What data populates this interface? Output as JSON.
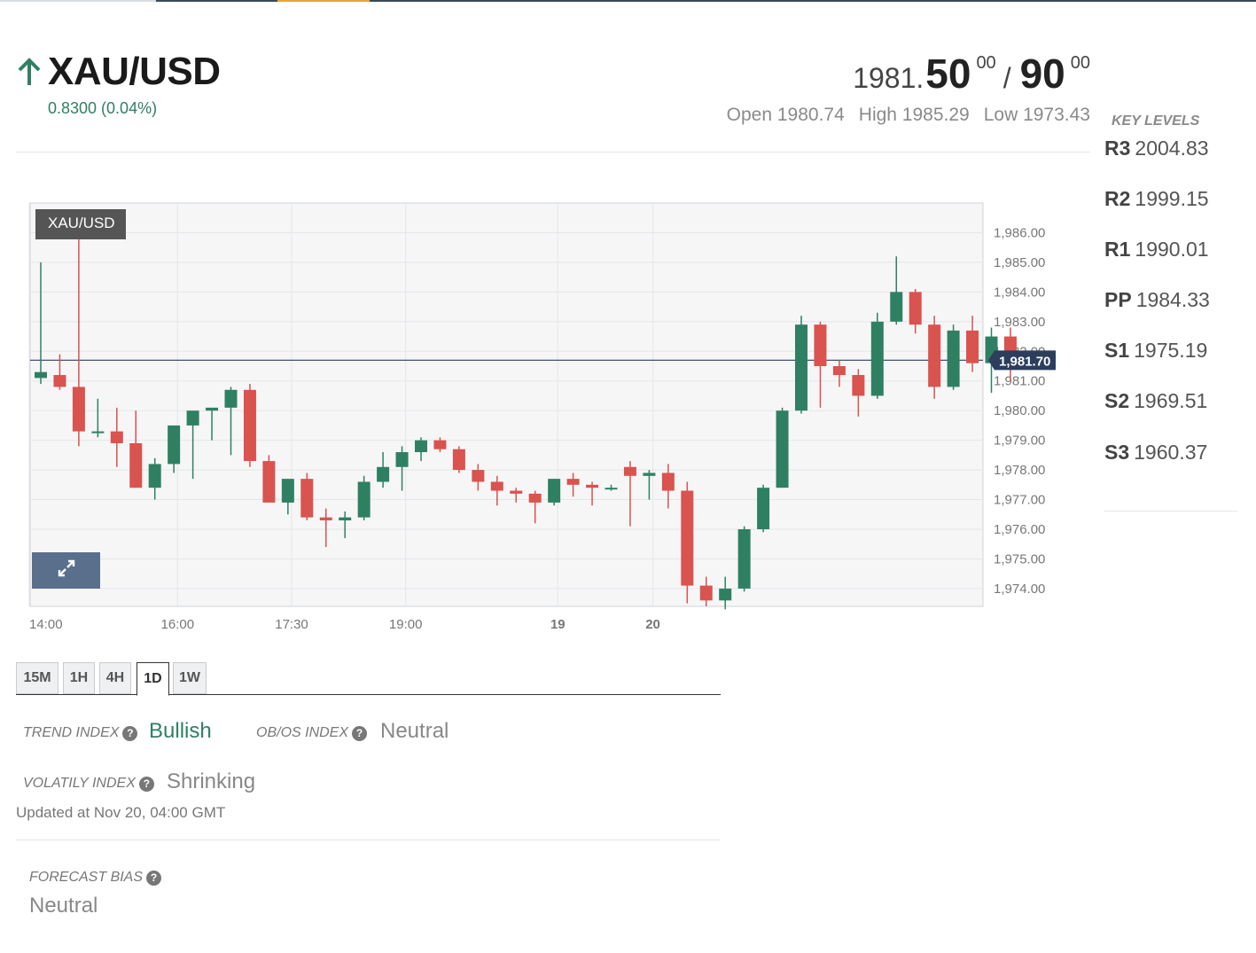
{
  "header": {
    "symbol": "XAU/USD",
    "change": "0.8300 (0.04%)",
    "direction_icon": "arrow-up-icon",
    "bid_main": "1981.",
    "bid_big": "50",
    "bid_sup": "00",
    "separator": "/",
    "ask_big": "90",
    "ask_sup": "00",
    "open": "Open 1980.74",
    "high": "High 1985.29",
    "low": "Low 1973.43"
  },
  "key_levels": {
    "title": "KEY LEVELS",
    "items": [
      {
        "label": "R3",
        "value": "2004.83"
      },
      {
        "label": "R2",
        "value": "1999.15"
      },
      {
        "label": "R1",
        "value": "1990.01"
      },
      {
        "label": "PP",
        "value": "1984.33"
      },
      {
        "label": "S1",
        "value": "1975.19"
      },
      {
        "label": "S2",
        "value": "1969.51"
      },
      {
        "label": "S3",
        "value": "1960.37"
      }
    ]
  },
  "chart_tag": "XAU/USD",
  "expand_icon": "expand-icon",
  "tabs": [
    {
      "label": "15M",
      "active": false
    },
    {
      "label": "1H",
      "active": false
    },
    {
      "label": "4H",
      "active": false
    },
    {
      "label": "1D",
      "active": true
    },
    {
      "label": "1W",
      "active": false
    }
  ],
  "indicators": {
    "trend_label": "TREND INDEX",
    "trend_value": "Bullish",
    "obos_label": "OB/OS INDEX",
    "obos_value": "Neutral",
    "volatility_label": "VOLATILY INDEX",
    "volatility_value": "Shrinking",
    "updated": "Updated at Nov 20, 04:00 GMT",
    "forecast_label": "FORECAST BIAS",
    "forecast_value": "Neutral"
  },
  "colors": {
    "bull": "#2f8062",
    "bear": "#d9534f",
    "price_line": "#2c3e5c"
  },
  "chart_data": {
    "type": "candlestick",
    "title": "",
    "y_ticks": [
      "1,986.00",
      "1,985.00",
      "1,984.00",
      "1,983.00",
      "1,982.00",
      "1,981.00",
      "1,980.00",
      "1,979.00",
      "1,978.00",
      "1,977.00",
      "1,976.00",
      "1,975.00",
      "1,974.00"
    ],
    "ylim": [
      1973.4,
      1987.0
    ],
    "x_labels": [
      {
        "label": "14:00",
        "bold": false,
        "slot": 0
      },
      {
        "label": "16:00",
        "bold": false,
        "slot": 7.8
      },
      {
        "label": "17:30",
        "bold": false,
        "slot": 13.8
      },
      {
        "label": "19:00",
        "bold": false,
        "slot": 19.8
      },
      {
        "label": "19",
        "bold": true,
        "slot": 27.8
      },
      {
        "label": "20",
        "bold": true,
        "slot": 32.8
      }
    ],
    "current_price": 1981.7,
    "current_price_label": "1,981.70",
    "candles": [
      {
        "o": 1981.1,
        "h": 1985.0,
        "l": 1980.9,
        "c": 1981.3
      },
      {
        "o": 1981.2,
        "h": 1981.9,
        "l": 1980.7,
        "c": 1980.8
      },
      {
        "o": 1980.8,
        "h": 1986.4,
        "l": 1978.8,
        "c": 1979.3
      },
      {
        "o": 1979.3,
        "h": 1980.4,
        "l": 1979.1,
        "c": 1979.3
      },
      {
        "o": 1979.3,
        "h": 1980.1,
        "l": 1978.1,
        "c": 1978.9
      },
      {
        "o": 1978.9,
        "h": 1980.0,
        "l": 1977.4,
        "c": 1977.4
      },
      {
        "o": 1977.4,
        "h": 1978.4,
        "l": 1977.0,
        "c": 1978.2
      },
      {
        "o": 1978.2,
        "h": 1979.4,
        "l": 1977.9,
        "c": 1979.5
      },
      {
        "o": 1979.5,
        "h": 1979.9,
        "l": 1977.7,
        "c": 1980.0
      },
      {
        "o": 1980.0,
        "h": 1980.0,
        "l": 1979.0,
        "c": 1980.1
      },
      {
        "o": 1980.1,
        "h": 1980.8,
        "l": 1978.5,
        "c": 1980.7
      },
      {
        "o": 1980.7,
        "h": 1980.9,
        "l": 1978.1,
        "c": 1978.3
      },
      {
        "o": 1978.3,
        "h": 1978.5,
        "l": 1977.1,
        "c": 1976.9
      },
      {
        "o": 1976.9,
        "h": 1977.1,
        "l": 1976.5,
        "c": 1977.7
      },
      {
        "o": 1977.7,
        "h": 1977.9,
        "l": 1976.3,
        "c": 1976.4
      },
      {
        "o": 1976.4,
        "h": 1976.7,
        "l": 1975.4,
        "c": 1976.3
      },
      {
        "o": 1976.3,
        "h": 1976.6,
        "l": 1975.7,
        "c": 1976.4
      },
      {
        "o": 1976.4,
        "h": 1977.8,
        "l": 1976.3,
        "c": 1977.6
      },
      {
        "o": 1977.6,
        "h": 1978.6,
        "l": 1977.4,
        "c": 1978.1
      },
      {
        "o": 1978.1,
        "h": 1978.8,
        "l": 1977.3,
        "c": 1978.6
      },
      {
        "o": 1978.6,
        "h": 1979.1,
        "l": 1978.3,
        "c": 1979.0
      },
      {
        "o": 1979.0,
        "h": 1979.1,
        "l": 1978.6,
        "c": 1978.7
      },
      {
        "o": 1978.7,
        "h": 1978.8,
        "l": 1977.9,
        "c": 1978.0
      },
      {
        "o": 1978.0,
        "h": 1978.2,
        "l": 1977.3,
        "c": 1977.6
      },
      {
        "o": 1977.6,
        "h": 1977.8,
        "l": 1976.8,
        "c": 1977.3
      },
      {
        "o": 1977.3,
        "h": 1977.4,
        "l": 1976.9,
        "c": 1977.2
      },
      {
        "o": 1977.2,
        "h": 1977.3,
        "l": 1976.2,
        "c": 1976.9
      },
      {
        "o": 1976.9,
        "h": 1977.7,
        "l": 1976.8,
        "c": 1977.7
      },
      {
        "o": 1977.7,
        "h": 1977.9,
        "l": 1977.1,
        "c": 1977.5
      },
      {
        "o": 1977.5,
        "h": 1977.6,
        "l": 1976.8,
        "c": 1977.4
      },
      {
        "o": 1977.4,
        "h": 1977.5,
        "l": 1977.3,
        "c": 1977.4
      },
      {
        "o": 1978.1,
        "h": 1978.3,
        "l": 1976.1,
        "c": 1977.8
      },
      {
        "o": 1977.8,
        "h": 1978.0,
        "l": 1977.0,
        "c": 1977.9
      },
      {
        "o": 1977.9,
        "h": 1978.2,
        "l": 1976.7,
        "c": 1977.3
      },
      {
        "o": 1977.3,
        "h": 1977.6,
        "l": 1973.5,
        "c": 1974.1
      },
      {
        "o": 1974.1,
        "h": 1974.4,
        "l": 1973.4,
        "c": 1973.6
      },
      {
        "o": 1973.6,
        "h": 1974.4,
        "l": 1973.3,
        "c": 1974.0
      },
      {
        "o": 1974.0,
        "h": 1976.1,
        "l": 1973.9,
        "c": 1976.0
      },
      {
        "o": 1976.0,
        "h": 1977.5,
        "l": 1975.9,
        "c": 1977.4
      },
      {
        "o": 1977.4,
        "h": 1980.1,
        "l": 1977.4,
        "c": 1980.0
      },
      {
        "o": 1980.0,
        "h": 1983.2,
        "l": 1979.9,
        "c": 1982.9
      },
      {
        "o": 1982.9,
        "h": 1983.0,
        "l": 1980.1,
        "c": 1981.5
      },
      {
        "o": 1981.5,
        "h": 1981.7,
        "l": 1980.8,
        "c": 1981.2
      },
      {
        "o": 1981.2,
        "h": 1981.4,
        "l": 1979.8,
        "c": 1980.5
      },
      {
        "o": 1980.5,
        "h": 1983.3,
        "l": 1980.4,
        "c": 1983.0
      },
      {
        "o": 1983.0,
        "h": 1985.2,
        "l": 1982.9,
        "c": 1984.0
      },
      {
        "o": 1984.0,
        "h": 1984.1,
        "l": 1982.6,
        "c": 1982.9
      },
      {
        "o": 1982.9,
        "h": 1983.2,
        "l": 1980.4,
        "c": 1980.8
      },
      {
        "o": 1980.8,
        "h": 1982.9,
        "l": 1980.7,
        "c": 1982.7
      },
      {
        "o": 1982.7,
        "h": 1983.2,
        "l": 1981.3,
        "c": 1981.6
      },
      {
        "o": 1981.6,
        "h": 1982.8,
        "l": 1980.6,
        "c": 1982.5
      },
      {
        "o": 1982.5,
        "h": 1982.8,
        "l": 1981.0,
        "c": 1981.8
      }
    ]
  }
}
